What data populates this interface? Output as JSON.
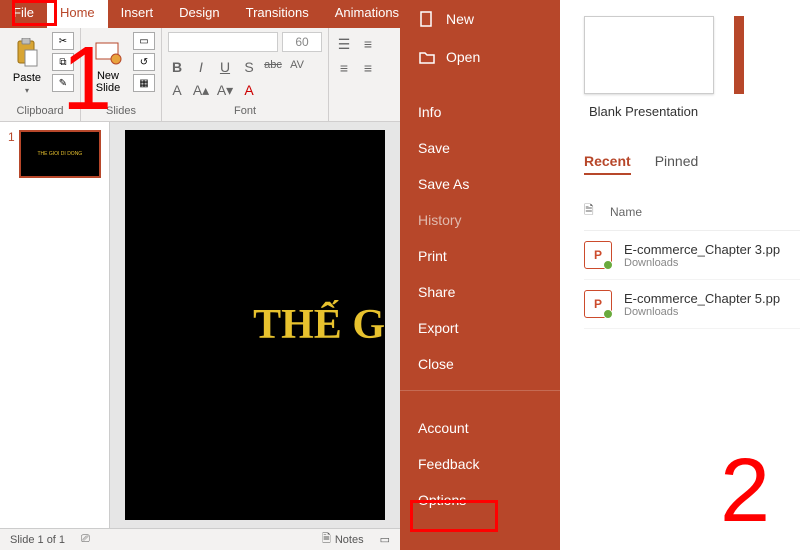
{
  "tabs": {
    "file": "File",
    "home": "Home",
    "insert": "Insert",
    "design": "Design",
    "transitions": "Transitions",
    "animations": "Animations"
  },
  "ribbon": {
    "clipboard": {
      "label": "Clipboard",
      "paste": "Paste"
    },
    "slides": {
      "label": "Slides",
      "new_slide": "New\nSlide"
    },
    "font": {
      "label": "Font",
      "size": "60",
      "bold": "B",
      "italic": "I",
      "underline": "U",
      "strike": "S",
      "shadow": "abc",
      "av": "AV"
    },
    "paragraph": {
      "label": ""
    }
  },
  "thumb": {
    "num": "1",
    "title": "THE GIOI DI DONG"
  },
  "slide_title": "THẾ G",
  "status": {
    "slide": "Slide 1 of 1",
    "notes": "Notes"
  },
  "file_menu": {
    "new": "New",
    "open": "Open",
    "info": "Info",
    "save": "Save",
    "save_as": "Save As",
    "history": "History",
    "print": "Print",
    "share": "Share",
    "export": "Export",
    "close": "Close",
    "account": "Account",
    "feedback": "Feedback",
    "options": "Options"
  },
  "start": {
    "blank": "Blank Presentation",
    "tabs": {
      "recent": "Recent",
      "pinned": "Pinned"
    },
    "table": {
      "col_name": "Name",
      "rows": [
        {
          "name": "E-commerce_Chapter 3.pp",
          "loc": "Downloads"
        },
        {
          "name": "E-commerce_Chapter 5.pp",
          "loc": "Downloads"
        }
      ]
    }
  },
  "callouts": {
    "one": "1",
    "two": "2"
  }
}
